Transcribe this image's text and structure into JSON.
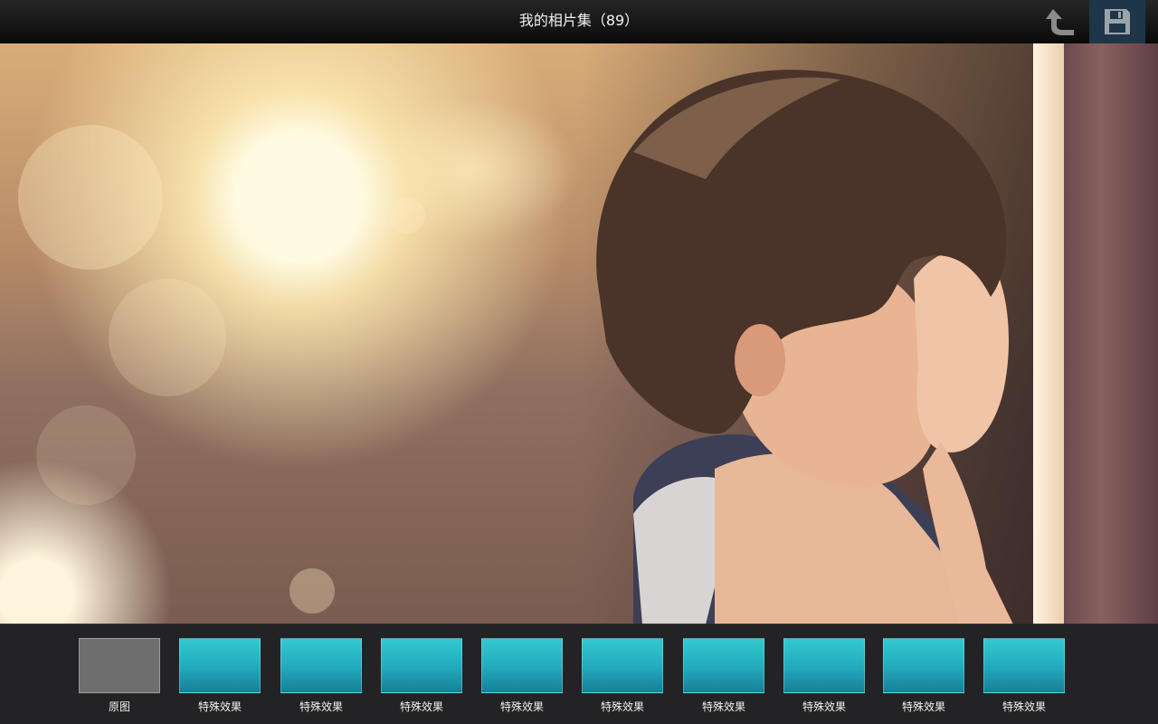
{
  "header": {
    "title": "我的相片集（89）",
    "back_icon": "back-arrow-icon",
    "save_icon": "floppy-disk-save-icon"
  },
  "photo": {
    "description_icon": "photo-canvas"
  },
  "filters": [
    {
      "label": "原图",
      "selected": true,
      "color": "#6e6e6e"
    },
    {
      "label": "特殊效果",
      "color": "#2bbbc8"
    },
    {
      "label": "特殊效果",
      "color": "#2bbbc8"
    },
    {
      "label": "特殊效果",
      "color": "#2bbbc8"
    },
    {
      "label": "特殊效果",
      "color": "#2bbbc8"
    },
    {
      "label": "特殊效果",
      "color": "#2bbbc8"
    },
    {
      "label": "特殊效果",
      "color": "#2bbbc8"
    },
    {
      "label": "特殊效果",
      "color": "#2bbbc8"
    },
    {
      "label": "特殊效果",
      "color": "#2bbbc8"
    },
    {
      "label": "特殊效果",
      "color": "#2bbbc8"
    }
  ],
  "colors": {
    "save_button_bg": "#1e3647",
    "strip_bg": "#28282a",
    "effect_thumb": "#2bbbc8"
  }
}
